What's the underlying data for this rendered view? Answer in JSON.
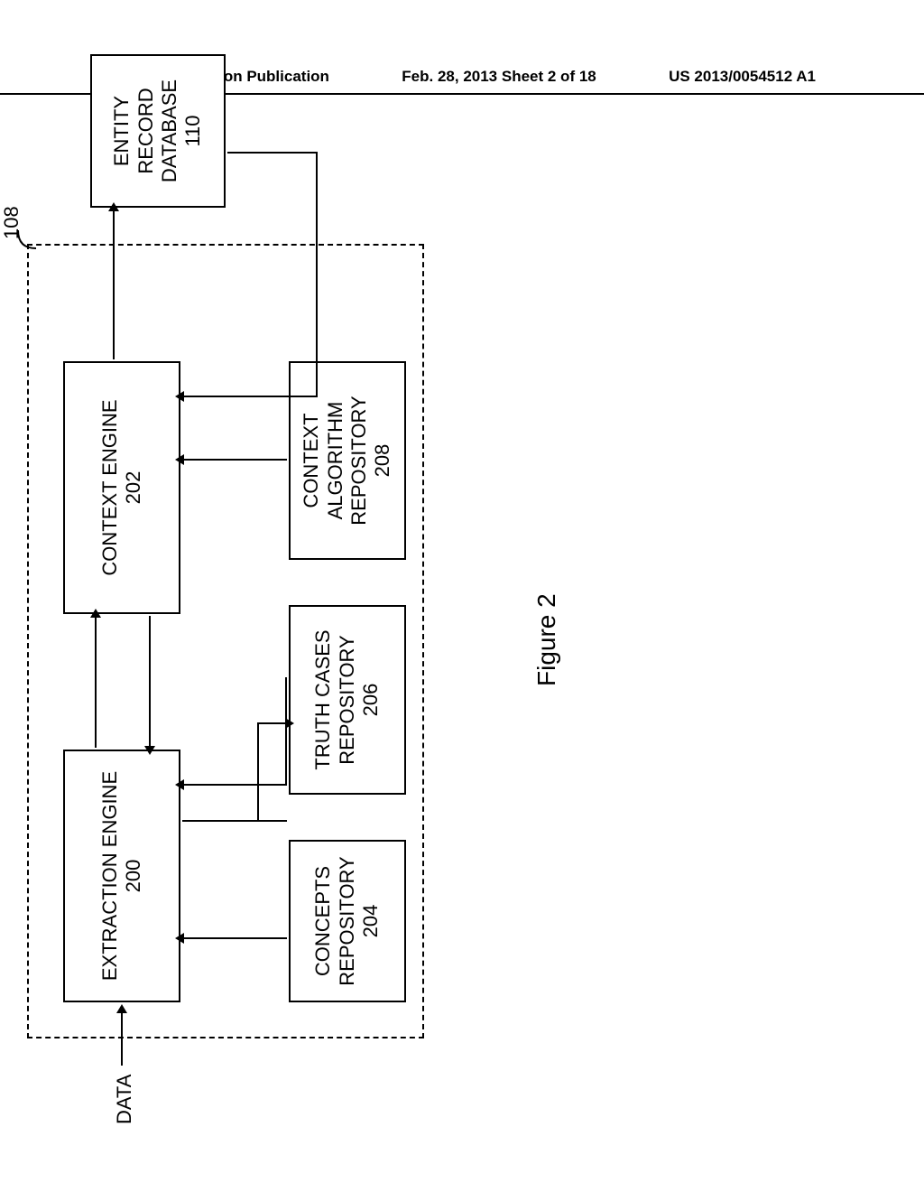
{
  "header": {
    "left": "Patent Application Publication",
    "center": "Feb. 28, 2013  Sheet 2 of 18",
    "right": "US 2013/0054512 A1"
  },
  "diagram": {
    "system_ref": "108",
    "data_label": "DATA",
    "figure_label": "Figure 2",
    "boxes": {
      "extraction_engine": {
        "name": "EXTRACTION ENGINE",
        "ref": "200"
      },
      "context_engine": {
        "name": "CONTEXT ENGINE",
        "ref": "202"
      },
      "concepts_repo": {
        "name": "CONCEPTS REPOSITORY",
        "ref": "204"
      },
      "truth_cases_repo": {
        "name": "TRUTH CASES REPOSITORY",
        "ref": "206"
      },
      "context_algo_repo": {
        "name": "CONTEXT ALGORITHM REPOSITORY",
        "ref": "208"
      },
      "entity_db": {
        "name": "ENTITY RECORD DATABASE",
        "ref": "110"
      }
    }
  }
}
